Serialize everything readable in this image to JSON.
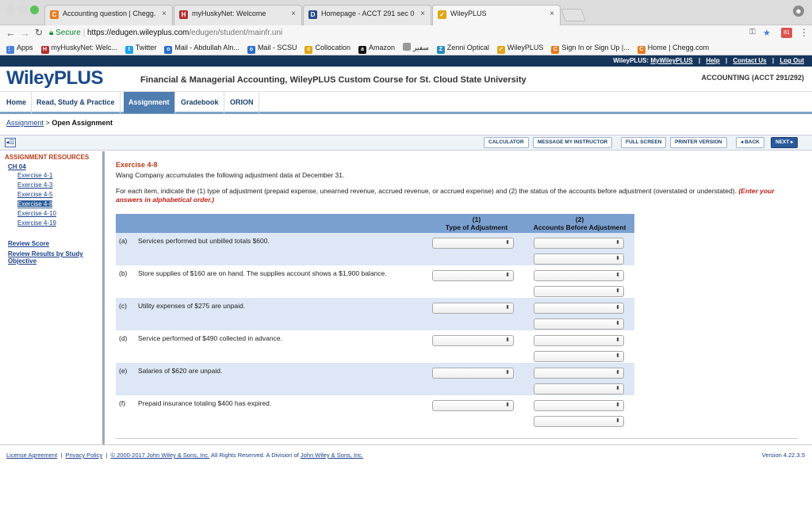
{
  "browser": {
    "tabs": [
      {
        "title": "Accounting question | Chegg.",
        "icon": "C",
        "color": "#e77b1f"
      },
      {
        "title": "myHuskyNet: Welcome",
        "icon": "H",
        "color": "#b23030"
      },
      {
        "title": "Homepage - ACCT 291 sec 0",
        "icon": "D",
        "color": "#2a4b8a"
      },
      {
        "title": "WileyPLUS",
        "icon": "✓",
        "color": "#e0a818"
      }
    ],
    "address": {
      "secure": "Secure",
      "host": "https://edugen.wileyplus.com",
      "path": "/edugen/student/mainfr.uni"
    },
    "extension_badge": "81",
    "bookmarks": [
      {
        "label": "Apps",
        "icon": "⋮⋮",
        "color": "#4a7fdc"
      },
      {
        "label": "myHuskyNet: Welc...",
        "icon": "H",
        "color": "#b23030"
      },
      {
        "label": "Twitter",
        "icon": "t",
        "color": "#1da1f2"
      },
      {
        "label": "Mail - Abdullah Aln...",
        "icon": "o",
        "color": "#2a6fc8"
      },
      {
        "label": "Mail - SCSU",
        "icon": "o",
        "color": "#2a6fc8"
      },
      {
        "label": "Collocation",
        "icon": "c",
        "color": "#e0a818"
      },
      {
        "label": "Amazon",
        "icon": "a",
        "color": "#111"
      },
      {
        "label": "سفير",
        "icon": "",
        "color": "#999"
      },
      {
        "label": "Zenni Optical",
        "icon": "Z",
        "color": "#2a8ac0"
      },
      {
        "label": "WileyPLUS",
        "icon": "✓",
        "color": "#e0a818"
      },
      {
        "label": "Sign In or Sign Up |...",
        "icon": "C",
        "color": "#e77b1f"
      },
      {
        "label": "Home | Chegg.com",
        "icon": "C",
        "color": "#e77b1f"
      }
    ]
  },
  "wiley": {
    "top_links": {
      "brand": "WileyPLUS:",
      "my": "MyWileyPLUS",
      "help": "Help",
      "contact": "Contact Us",
      "logout": "Log Out",
      "sep": "|"
    },
    "logo": "WileyPLUS",
    "course_title": "Financial & Managerial Accounting, WileyPLUS Custom Course for St. Cloud State University",
    "course_code": "ACCOUNTING (ACCT 291/292)",
    "nav": [
      "Home",
      "Read, Study & Practice",
      "Assignment",
      "Gradebook",
      "ORION"
    ],
    "breadcrumb": {
      "link": "Assignment",
      "sep": ">",
      "current": "Open Assignment"
    },
    "toolbar": {
      "calculator": "CALCULATOR",
      "message": "MESSAGE MY INSTRUCTOR",
      "fullscreen": "FULL SCREEN",
      "printer": "PRINTER VERSION",
      "back": "◂ BACK",
      "next": "NEXT ▸"
    },
    "sidebar": {
      "title": "ASSIGNMENT RESOURCES",
      "chapter": "CH 04",
      "exercises": [
        "Exercise 4-1",
        "Exercise 4-3",
        "Exercise 4-5",
        "Exercise 4-8",
        "Exercise 4-10",
        "Exercise 4-19"
      ],
      "review_score": "Review Score",
      "review_results_1": "Review Results by Study",
      "review_results_2": "Objective"
    },
    "exercise": {
      "title": "Exercise 4-8",
      "description": "Wang Company accumulates the following adjustment data at December 31.",
      "instructions": "For each item, indicate the (1) type of adjustment (prepaid expense, unearned revenue, accrued revenue, or accrued expense) and (2) the status of the accounts before adjustment (overstated or understated).",
      "instructions_red": "(Enter your answers in alphabetical order.)"
    },
    "table": {
      "col1_num": "(1)",
      "col1": "Type of Adjustment",
      "col2_num": "(2)",
      "col2": "Accounts Before Adjustment",
      "rows": [
        {
          "label": "(a)",
          "text": "Services performed but unbilled totals $600."
        },
        {
          "label": "(b)",
          "text": "Store supplies of $160 are on hand. The supplies account shows a $1,900 balance."
        },
        {
          "label": "(c)",
          "text": "Utility expenses of $275 are unpaid."
        },
        {
          "label": "(d)",
          "text": "Service performed of $490 collected in advance."
        },
        {
          "label": "(e)",
          "text": "Salaries of $620 are unpaid."
        },
        {
          "label": "(f)",
          "text": "Prepaid insurance totaling $400 has expired."
        }
      ]
    },
    "footer": {
      "license": "License Agreement",
      "privacy": "Privacy Policy",
      "copyright": "© 2000-2017 John Wiley & Sons, Inc.",
      "rights": "All Rights Reserved. A Division of",
      "wiley": "John Wiley & Sons, Inc.",
      "version": "Version 4.22.3.5",
      "sep": "|"
    }
  }
}
